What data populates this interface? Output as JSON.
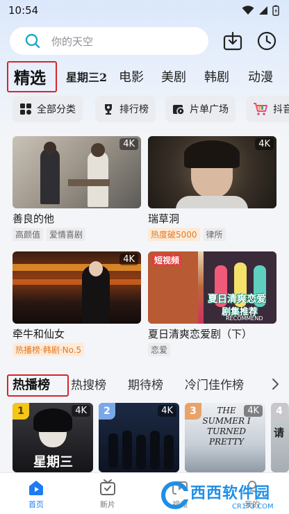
{
  "status": {
    "time": "10:54"
  },
  "search": {
    "placeholder": "你的天空"
  },
  "category_tabs": [
    {
      "label": "精选"
    },
    {
      "label": "星期三2"
    },
    {
      "label": "电影"
    },
    {
      "label": "美剧"
    },
    {
      "label": "韩剧"
    },
    {
      "label": "动漫"
    }
  ],
  "quick_links": [
    {
      "label": "全部分类",
      "icon": "grid-icon"
    },
    {
      "label": "排行榜",
      "icon": "trophy-icon"
    },
    {
      "label": "片单广场",
      "icon": "playlist-icon"
    },
    {
      "label": "抖音",
      "icon": "cart-icon"
    }
  ],
  "cards": [
    {
      "title": "善良的他",
      "badge": "4K",
      "tags": [
        {
          "text": "高颜值",
          "hot": false
        },
        {
          "text": "爱情喜剧",
          "hot": false
        }
      ]
    },
    {
      "title": "瑞草洞",
      "badge": "4K",
      "tags": [
        {
          "text": "热度破5000",
          "hot": true
        },
        {
          "text": "律所",
          "hot": false
        }
      ]
    },
    {
      "title": "牵牛和仙女",
      "badge": "4K",
      "tags": [
        {
          "text": "热播榜·韩剧·No.5",
          "hot": true
        }
      ]
    },
    {
      "title": "夏日清爽恋爱剧（下）",
      "badge": "",
      "tags": [
        {
          "text": "恋爱",
          "hot": false
        }
      ],
      "poster_text": [
        "短视频",
        "夏日清爽恋爱",
        "剧集推荐",
        "RECOMMEND"
      ]
    }
  ],
  "rank_tabs": [
    {
      "label": "热播榜"
    },
    {
      "label": "热搜榜"
    },
    {
      "label": "期待榜"
    },
    {
      "label": "冷门佳作榜"
    }
  ],
  "rank_cards": [
    {
      "num": "1",
      "badge": "4K",
      "poster_title": "星期三",
      "num_color": "#f5c518"
    },
    {
      "num": "2",
      "badge": "4K",
      "poster_title": "",
      "num_color": "#7aa7e8"
    },
    {
      "num": "3",
      "badge": "4K",
      "poster_title": "THE SUMMER I TURNED PRETTY",
      "num_color": "#e8a36a"
    },
    {
      "num": "4",
      "badge": "",
      "poster_title": "请",
      "num_color": "#c7c7cc"
    }
  ],
  "bottom_nav": [
    {
      "label": "首页",
      "icon": "home-icon",
      "active": true
    },
    {
      "label": "新片",
      "icon": "tv-icon",
      "active": false
    },
    {
      "label": "视频",
      "icon": "video-icon",
      "active": false
    },
    {
      "label": "我的",
      "icon": "user-icon",
      "active": false
    }
  ],
  "watermark": {
    "brand": "西西软件园",
    "url": "CR173.COM"
  },
  "colors": {
    "accent": "#1d7cf2",
    "highlight_red": "#d6252b",
    "hot_orange": "#e27a23"
  }
}
